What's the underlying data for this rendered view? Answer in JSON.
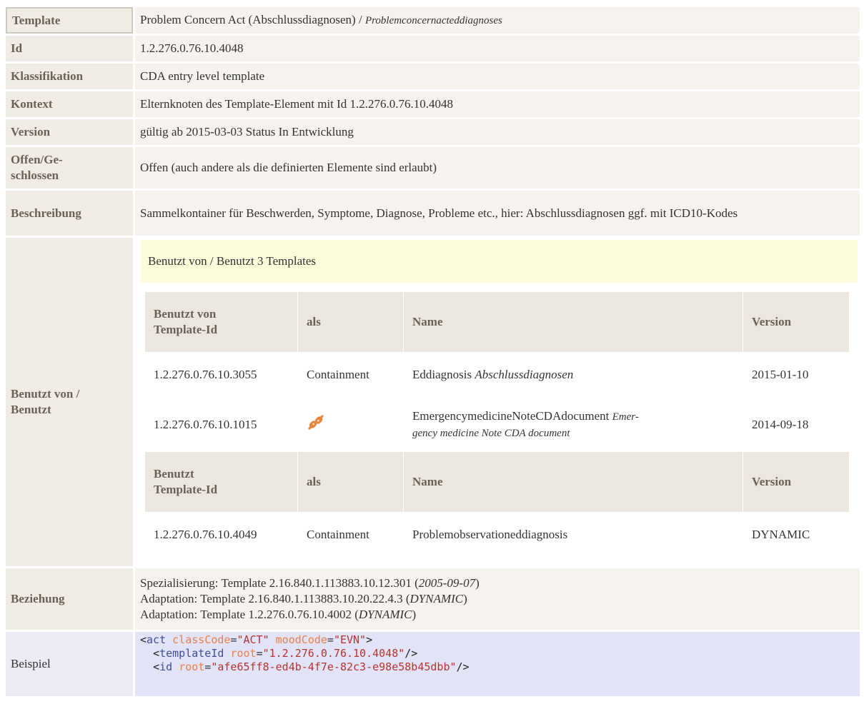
{
  "rows": {
    "template": {
      "label": "Template",
      "name": "Problem Concern Act (Abschlussdiagnosen)",
      "sep": " / ",
      "alias": "Problemconcernacteddiagnoses"
    },
    "id": {
      "label": "Id",
      "value": "1.2.276.0.76.10.4048"
    },
    "klassifikation": {
      "label": "Klassifikation",
      "value": "CDA entry level template"
    },
    "kontext": {
      "label": "Kontext",
      "value": "Elternknoten des Template-Element mit Id 1.2.276.0.76.10.4048"
    },
    "version": {
      "label": "Version",
      "value": "gültig ab 2015-03-03 Status In Entwicklung"
    },
    "offen": {
      "label_line1": "Offen/Ge-",
      "label_line2": "schlossen",
      "value": "Offen (auch andere als die definierten Elemente sind erlaubt)"
    },
    "beschreibung": {
      "label": "Beschreibung",
      "value": "Sammelkontainer für Beschwerden, Symptome, Diagnose, Probleme etc., hier: Abschlussdiagnosen ggf. mit ICD10-Kodes"
    },
    "benutzt": {
      "label_line1": "Benutzt von /",
      "label_line2": "Benutzt",
      "header": "Benutzt von / Benutzt 3 Templates",
      "used_by_columns": {
        "col1_line1": "Benutzt von",
        "col1_line2": "Template-Id",
        "col2": "als",
        "col3": "Name",
        "col4": "Version"
      },
      "used_by_rows": [
        {
          "id": "1.2.276.0.76.10.3055",
          "as": "Containment",
          "name": "Eddiagnosis",
          "name_alias": "Abschlussdiagnosen",
          "version": "2015-01-10"
        },
        {
          "id": "1.2.276.0.76.10.1015",
          "as_icon": "link-icon",
          "name_line1": "EmergencymedicineNoteCDAdocument",
          "name_alias_line1": "Emer-",
          "name_alias_line2": "gency medicine Note CDA document",
          "version": "2014-09-18"
        }
      ],
      "uses_columns": {
        "col1_line1": "Benutzt",
        "col1_line2": "Template-Id",
        "col2": "als",
        "col3": "Name",
        "col4": "Version"
      },
      "uses_rows": [
        {
          "id": "1.2.276.0.76.10.4049",
          "as": "Containment",
          "name": "Problemobservationeddiagnosis",
          "version": "DYNAMIC"
        }
      ]
    },
    "beziehung": {
      "label": "Beziehung",
      "lines": [
        {
          "text": "Spezialisierung: Template 2.16.840.1.113883.10.12.301 (",
          "date": "2005-09-07",
          "close": ")"
        },
        {
          "text": "Adaptation: Template 2.16.840.1.113883.10.20.22.4.3 (",
          "date": "DYNAMIC",
          "close": ")"
        },
        {
          "text": "Adaptation: Template 1.2.276.0.76.10.4002 (",
          "date": "DYNAMIC",
          "close": ")"
        }
      ]
    },
    "beispiel": {
      "label": "Beispiel",
      "line1": {
        "open": "<",
        "tag": "act",
        "a1": "classCode",
        "v1": "\"ACT\"",
        "a2": "moodCode",
        "v2": "\"EVN\"",
        "close": ">"
      },
      "line2": {
        "indent": "  ",
        "open": "<",
        "tag": "templateId",
        "a1": "root",
        "v1": "\"1.2.276.0.76.10.4048\"",
        "close": "/>"
      },
      "line3": {
        "indent": "  ",
        "open": "<",
        "tag": "id",
        "a1": "root",
        "v1": "\"afe65ff8-ed4b-4f7e-82c3-e98e58b45dbb\"",
        "close": "/>"
      }
    }
  },
  "colors": {
    "label_bg": "#f0ebe4",
    "value_bg": "#f6f3ef",
    "header_yellow": "#fcfcdb",
    "code_bg": "#e3e3f7",
    "link_icon": "#e8843c"
  }
}
